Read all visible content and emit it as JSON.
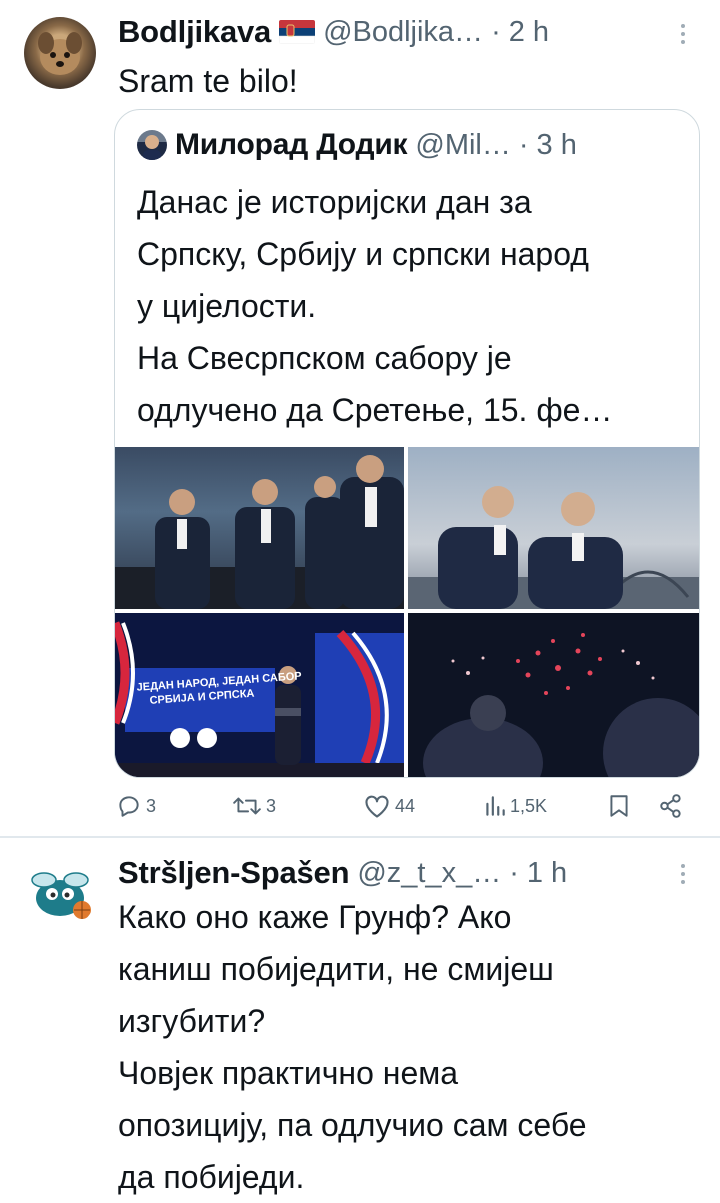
{
  "tweet1": {
    "display_name": "Bodljikava",
    "flag": "serbia-flag-icon",
    "handle": "@Bodljika…",
    "sep": "·",
    "time": "2 h",
    "text": "Sram te bilo!"
  },
  "quote": {
    "display_name": "Милорад Додик",
    "handle": "@Mil…",
    "sep": "·",
    "time": "3 h",
    "text": "Данас је историјски дан за\nСрпску, Србију и српски народ\nу цијелости.\nНа Свесрпском сабору је\nодлучено да Сретење, 15. фе…",
    "images": [
      "photo-1",
      "photo-2",
      "photo-3",
      "photo-4"
    ],
    "banner_text_1": "ЈЕДАН НАРОД, ЈЕДАН САБОР",
    "banner_text_2": "СРБИЈА И СРПСКА"
  },
  "actions": {
    "replies": "3",
    "reposts": "3",
    "likes": "44",
    "views": "1,5K"
  },
  "tweet2": {
    "display_name": "Stršljen-Spašen",
    "handle": "@z_t_x_…",
    "sep": "·",
    "time": "1 h",
    "text": "Како оно каже Грунф? Ако\nканиш побиједити, не смијеш\nизгубити?\nЧовјек практично нема\nопозицију, па одлучио сам себе\nда побиједи."
  },
  "colors": {
    "text": "#0f1419",
    "muted": "#536471",
    "border": "#cfd9de",
    "banner_blue": "#1f3fb5",
    "banner_red": "#d7263d"
  }
}
